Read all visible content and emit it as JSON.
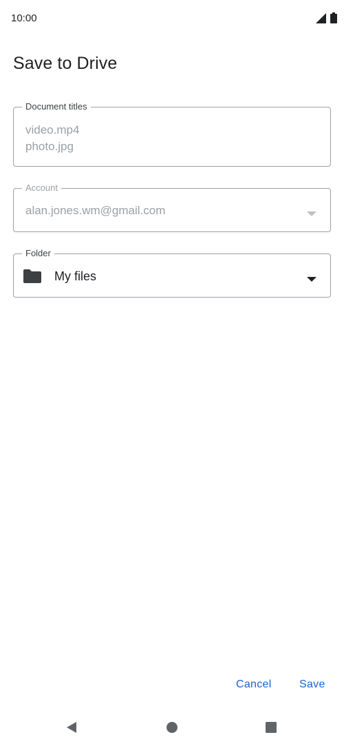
{
  "status_bar": {
    "time": "10:00",
    "icons": [
      "signal-icon",
      "battery-icon"
    ]
  },
  "title": "Save to Drive",
  "fields": {
    "titles": {
      "label": "Document titles",
      "lines": [
        "video.mp4",
        "photo.jpg"
      ]
    },
    "account": {
      "label": "Account",
      "value": "alan.jones.wm@gmail.com",
      "icon": "chevron-down-icon"
    },
    "folder": {
      "label": "Folder",
      "value": "My files",
      "icon": "folder-icon"
    }
  },
  "actions": {
    "cancel_label": "Cancel",
    "save_label": "Save"
  },
  "nav": {
    "icons": [
      "back-icon",
      "home-icon",
      "recents-icon"
    ]
  },
  "colors": {
    "accent": "#1a62c9",
    "muted_text": "#9aa0a6",
    "outline": "#9aa0a6"
  }
}
